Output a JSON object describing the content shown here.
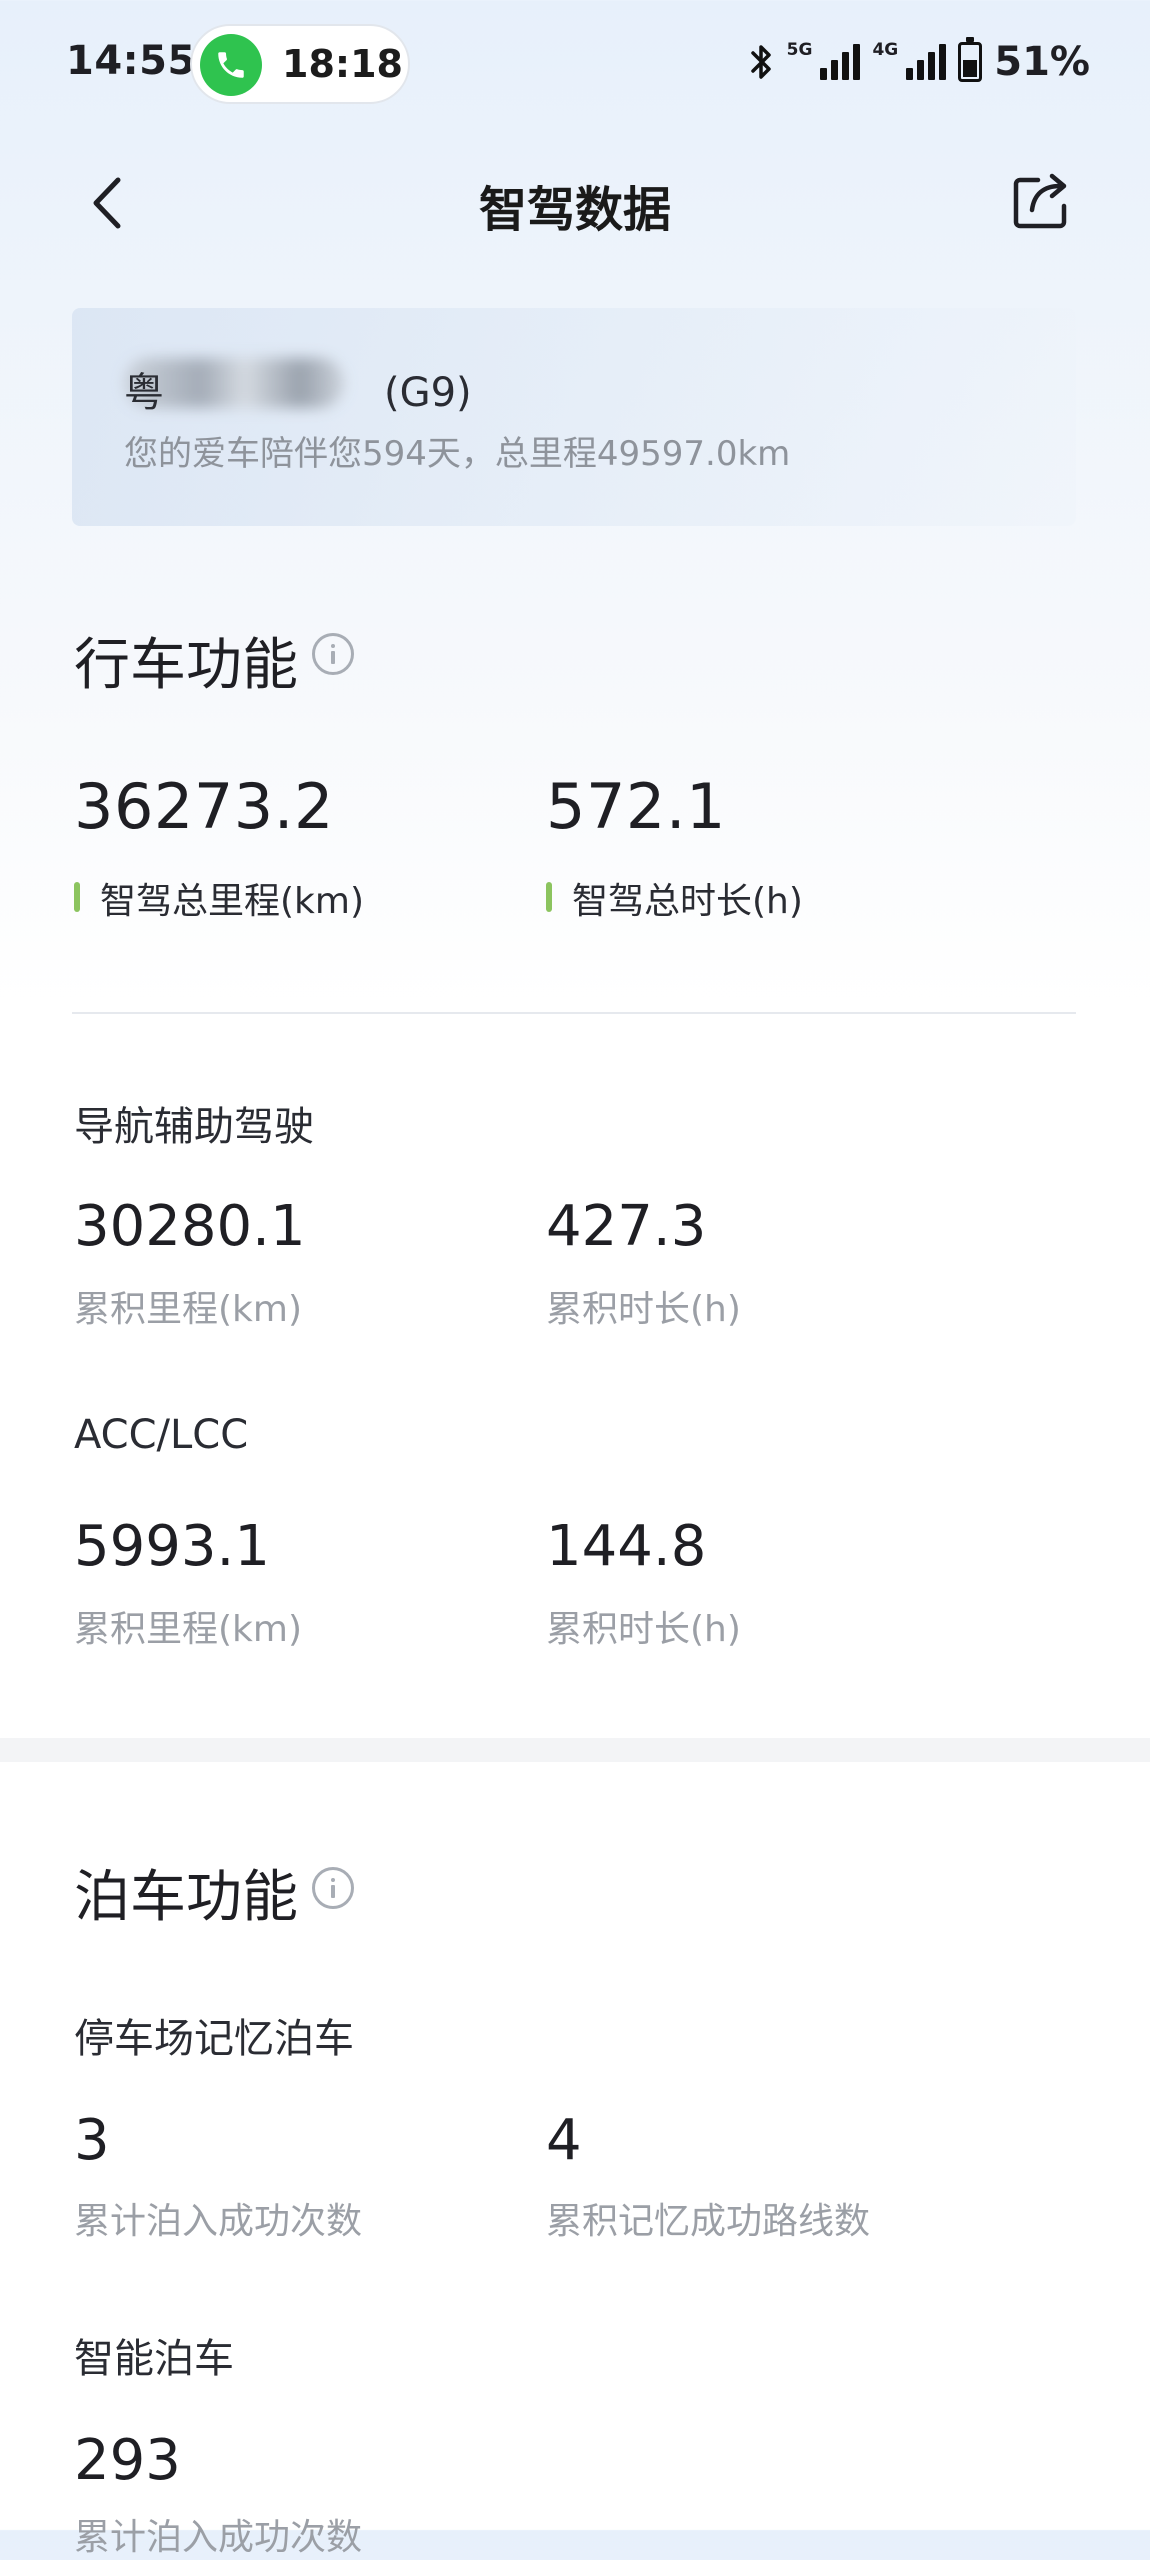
{
  "status_bar": {
    "time": "14:55",
    "call_duration": "18:18",
    "network_5g": "5G",
    "network_4g": "4G",
    "battery_percent": "51%",
    "battery_level": 0.51,
    "icons": [
      "phone-icon",
      "bluetooth-icon",
      "signal-icon",
      "battery-icon"
    ]
  },
  "nav": {
    "title": "智驾数据",
    "back_icon": "chevron-left-icon",
    "share_icon": "share-icon"
  },
  "car": {
    "plate_prefix": "粤",
    "model": "(G9)",
    "summary": "您的爱车陪伴您594天，总里程49597.0km"
  },
  "driving": {
    "title": "行车功能",
    "total_distance": "36273.2",
    "total_distance_label": "智驾总里程(km)",
    "total_time": "572.1",
    "total_time_label": "智驾总时长(h)",
    "nav_assist": {
      "title": "导航辅助驾驶",
      "distance": "30280.1",
      "distance_label": "累积里程(km)",
      "time": "427.3",
      "time_label": "累积时长(h)"
    },
    "acc_lcc": {
      "title": "ACC/LCC",
      "distance": "5993.1",
      "distance_label": "累积里程(km)",
      "time": "144.8",
      "time_label": "累积时长(h)"
    }
  },
  "parking": {
    "title": "泊车功能",
    "memory": {
      "title": "停车场记忆泊车",
      "count": "3",
      "count_label": "累计泊入成功次数",
      "routes": "4",
      "routes_label": "累积记忆成功路线数"
    },
    "smart": {
      "title": "智能泊车",
      "count": "293",
      "count_label": "累计泊入成功次数"
    }
  }
}
